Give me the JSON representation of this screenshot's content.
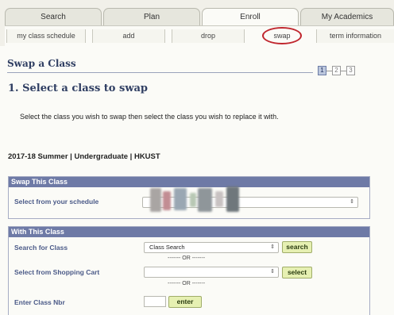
{
  "main_tabs": [
    {
      "label": "Search",
      "active": false
    },
    {
      "label": "Plan",
      "active": false
    },
    {
      "label": "Enroll",
      "active": true
    },
    {
      "label": "My Academics",
      "active": false
    }
  ],
  "sub_tabs": [
    {
      "label": "my class schedule",
      "active": false
    },
    {
      "label": "add",
      "active": false
    },
    {
      "label": "drop",
      "active": false
    },
    {
      "label": "swap",
      "active": true
    },
    {
      "label": "term information",
      "active": false
    }
  ],
  "page_title": "Swap a Class",
  "steps": [
    "1",
    "2",
    "3"
  ],
  "current_step": 1,
  "step_heading": "1.  Select a class to swap",
  "instructions": "Select the class you wish to swap then select the class you wish to replace it with.",
  "term": "2017-18 Summer | Undergraduate | HKUST",
  "swap_panel": {
    "header": "Swap This Class",
    "schedule_label": "Select from your schedule",
    "schedule_value": ""
  },
  "with_panel": {
    "header": "With This Class",
    "search_label": "Search for Class",
    "search_option": "Class Search",
    "search_button": "search",
    "or_text": "------- OR -------",
    "cart_label": "Select from Shopping Cart",
    "cart_value": "",
    "select_button": "select",
    "or_text_2": "------- OR -------",
    "class_nbr_label": "Enter Class Nbr",
    "class_nbr_value": "",
    "enter_button": "enter"
  },
  "colors": {
    "panel_header": "#6e7aa6",
    "label": "#4b5a88",
    "title": "#2f3e62",
    "button": "#e6f0b2",
    "highlight_circle": "#c0262e"
  }
}
